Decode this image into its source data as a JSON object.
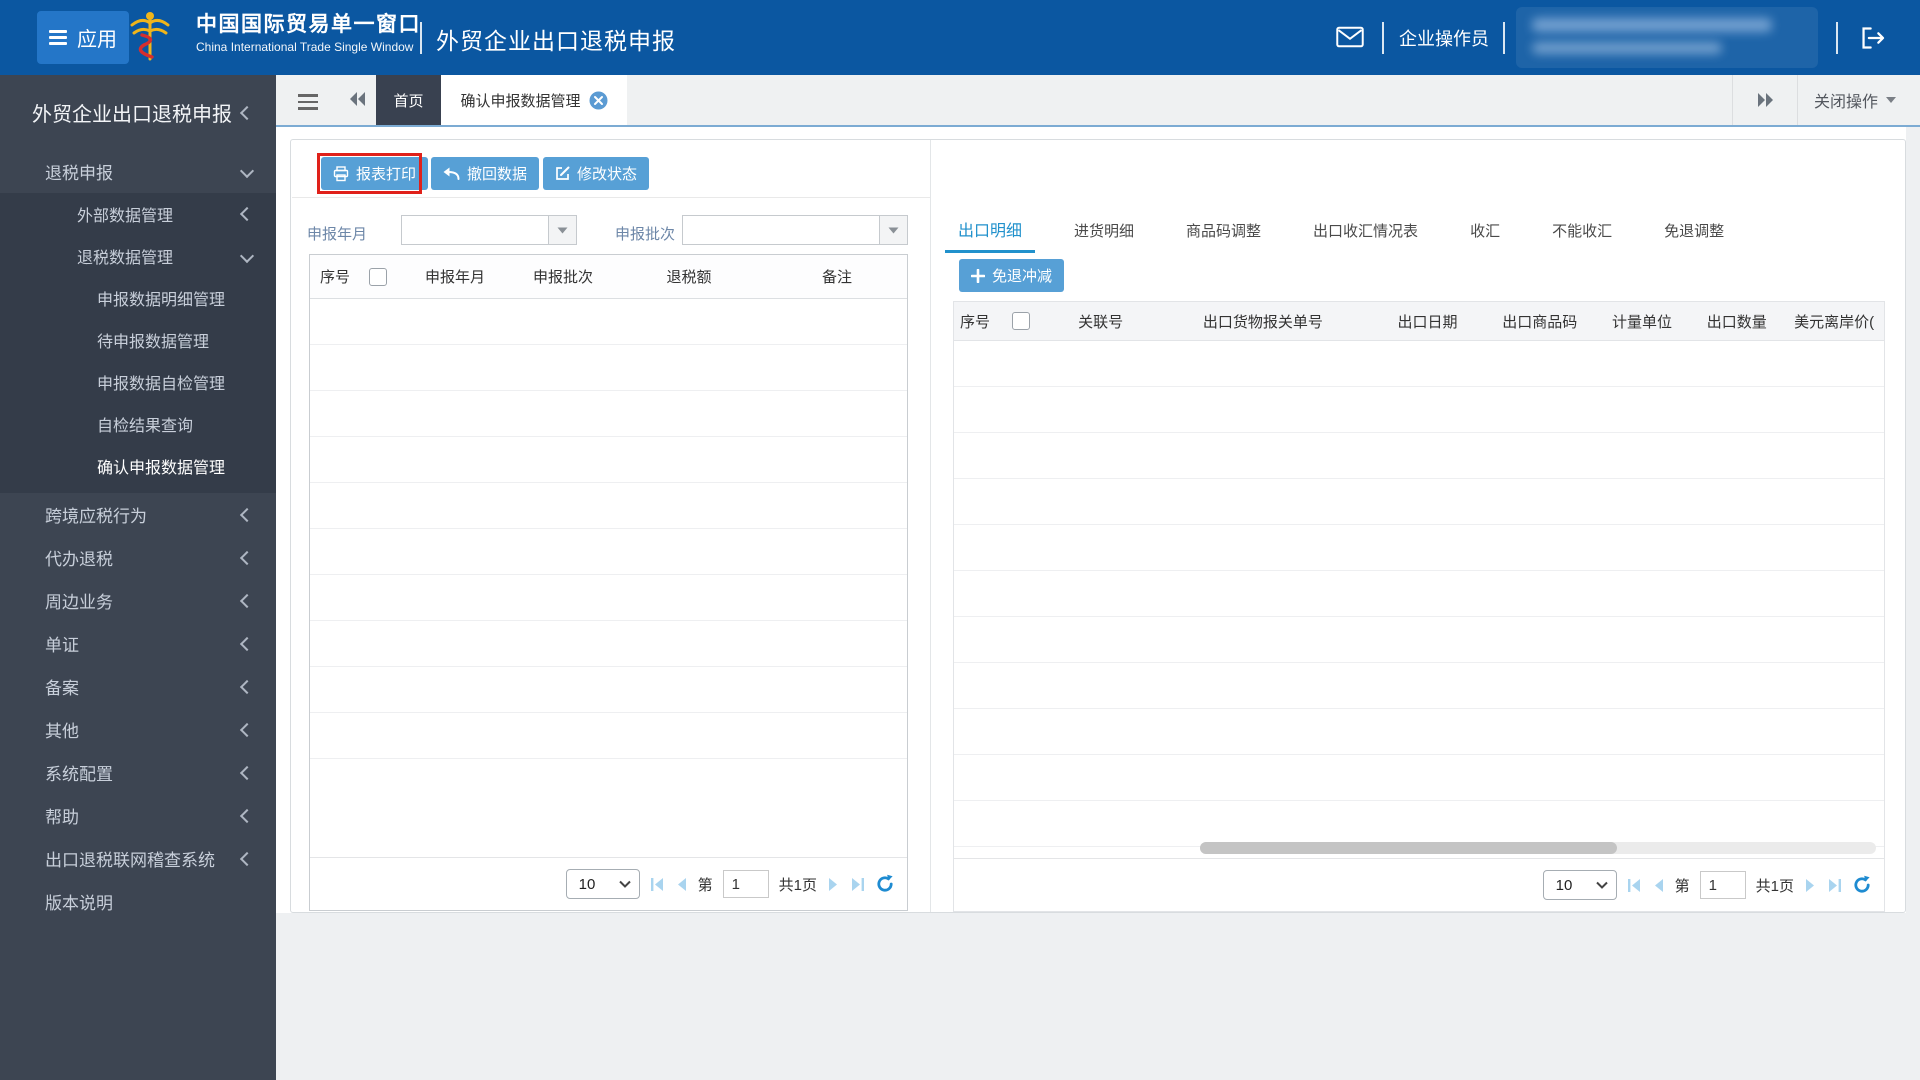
{
  "header": {
    "app_button": "应用",
    "brand_title": "中国国际贸易单一窗口",
    "brand_subtitle": "China International Trade Single Window",
    "product_title": "外贸企业出口退税申报",
    "user_role": "企业操作员"
  },
  "tabbar": {
    "home_tab": "首页",
    "active_tab": "确认申报数据管理",
    "close_ops": "关闭操作"
  },
  "sidebar": {
    "items": [
      {
        "label": "外贸企业出口退税申报"
      },
      {
        "label": "退税申报"
      },
      {
        "label": "外部数据管理"
      },
      {
        "label": "退税数据管理"
      },
      {
        "label": "申报数据明细管理"
      },
      {
        "label": "待申报数据管理"
      },
      {
        "label": "申报数据自检管理"
      },
      {
        "label": "自检结果查询"
      },
      {
        "label": "确认申报数据管理"
      },
      {
        "label": "跨境应税行为"
      },
      {
        "label": "代办退税"
      },
      {
        "label": "周边业务"
      },
      {
        "label": "单证"
      },
      {
        "label": "备案"
      },
      {
        "label": "其他"
      },
      {
        "label": "系统配置"
      },
      {
        "label": "帮助"
      },
      {
        "label": "出口退税联网稽查系统"
      },
      {
        "label": "版本说明"
      }
    ]
  },
  "toolbar": {
    "print": "报表打印",
    "withdraw": "撤回数据",
    "modify": "修改状态"
  },
  "left_panel": {
    "filter_year_label": "申报年月",
    "filter_batch_label": "申报批次",
    "headers": [
      "序号",
      "申报年月",
      "申报批次",
      "退税额",
      "备注"
    ],
    "pagination": {
      "page_size": "10",
      "prefix": "第",
      "page": "1",
      "total": "共1页"
    }
  },
  "right_panel": {
    "tabs": [
      "出口明细",
      "进货明细",
      "商品码调整",
      "出口收汇情况表",
      "收汇",
      "不能收汇",
      "免退调整"
    ],
    "add_button": "免退冲减",
    "headers": [
      "序号",
      "关联号",
      "出口货物报关单号",
      "出口日期",
      "出口商品码",
      "计量单位",
      "出口数量",
      "美元离岸价("
    ],
    "pagination": {
      "page_size": "10",
      "prefix": "第",
      "page": "1",
      "total": "共1页"
    }
  },
  "colors": {
    "header_blue": "#0b57a1",
    "accent_blue": "#57a0d6",
    "active_tab_blue": "#2191cc",
    "highlight_red": "#e0211a",
    "sidebar_bg": "#3d4552"
  }
}
